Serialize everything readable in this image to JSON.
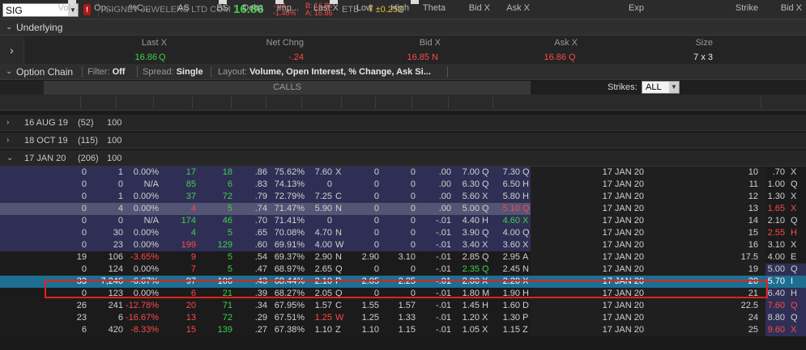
{
  "topbar": {
    "symbol": "SIG",
    "company": "SIGNET JEWELERS LTD COM",
    "last": "16.86",
    "net_change": "-.24",
    "pct_change": "-1.40%",
    "bid": "B: 16.85",
    "ask": "A: 16.86",
    "etb": "ETB",
    "hilo": "±0.252"
  },
  "underlying": {
    "title": "Underlying",
    "headers": [
      "Last X",
      "Net Chng",
      "Bid X",
      "Ask X",
      "Size"
    ],
    "last": "16.86",
    "last_ex": "Q",
    "net_chng": "-.24",
    "bid": "16.85",
    "bid_ex": "N",
    "ask": "16.86",
    "ask_ex": "Q",
    "size": "7 x 3"
  },
  "toolbar": {
    "title": "Option Chain",
    "filter_label": "Filter:",
    "filter_value": "Off",
    "spread_label": "Spread:",
    "spread_value": "Single",
    "layout_label": "Layout:",
    "layout_value": "Volume, Open Interest, % Change, Ask Si..."
  },
  "calls_label": "CALLS",
  "strikes": {
    "label": "Strikes:",
    "value": "ALL"
  },
  "columns": [
    "Vol...",
    "Op...",
    "%C...",
    "AS",
    "BS",
    "Delta",
    "Imp...",
    "Last X",
    "Low",
    "High",
    "Theta",
    "Bid X",
    "Ask X",
    "Exp",
    "Strike",
    "Bid X"
  ],
  "expirations": [
    {
      "label": "16 AUG 19",
      "count": "(52)",
      "mult": "100"
    },
    {
      "label": "18 OCT 19",
      "count": "(115)",
      "mult": "100"
    },
    {
      "label": "17 JAN 20",
      "count": "(206)",
      "mult": "100"
    }
  ],
  "rows": [
    {
      "vol": "0",
      "oi": "1",
      "pct": "0.00%",
      "as": "17",
      "bs": "18",
      "delta": ".86",
      "imp": "75.62%",
      "last": "7.60",
      "lx": "X",
      "low": "0",
      "high": "0",
      "theta": ".00",
      "bid": "7.00",
      "bx": "Q",
      "ask": "7.30",
      "ax": "Q",
      "exp": "17 JAN 20",
      "strike": "10",
      "pbid": ".70",
      "pbx": "X"
    },
    {
      "vol": "0",
      "oi": "0",
      "pct": "N/A",
      "as": "85",
      "bs": "6",
      "delta": ".83",
      "imp": "74.13%",
      "last": "0",
      "lx": "",
      "low": "0",
      "high": "0",
      "theta": ".00",
      "bid": "6.30",
      "bx": "Q",
      "ask": "6.50",
      "ax": "H",
      "exp": "17 JAN 20",
      "strike": "11",
      "pbid": "1.00",
      "pbx": "Q"
    },
    {
      "vol": "0",
      "oi": "1",
      "pct": "0.00%",
      "as": "37",
      "bs": "72",
      "delta": ".79",
      "imp": "72.79%",
      "last": "7.25",
      "lx": "C",
      "low": "0",
      "high": "0",
      "theta": ".00",
      "bid": "5.60",
      "bx": "X",
      "ask": "5.80",
      "ax": "H",
      "exp": "17 JAN 20",
      "strike": "12",
      "pbid": "1.30",
      "pbx": "X"
    },
    {
      "vol": "0",
      "oi": "4",
      "pct": "0.00%",
      "as": "4",
      "bs": "5",
      "delta": ".74",
      "imp": "71.47%",
      "last": "5.90",
      "lx": "N",
      "low": "0",
      "high": "0",
      "theta": ".00",
      "bid": "5.00",
      "bx": "Q",
      "ask": "5.10",
      "ax": "Q",
      "exp": "17 JAN 20",
      "strike": "13",
      "pbid": "1.65",
      "pbx": "X"
    },
    {
      "vol": "0",
      "oi": "0",
      "pct": "N/A",
      "as": "174",
      "bs": "46",
      "delta": ".70",
      "imp": "71.41%",
      "last": "0",
      "lx": "",
      "low": "0",
      "high": "0",
      "theta": "-.01",
      "bid": "4.40",
      "bx": "H",
      "ask": "4.60",
      "ax": "X",
      "exp": "17 JAN 20",
      "strike": "14",
      "pbid": "2.10",
      "pbx": "Q"
    },
    {
      "vol": "0",
      "oi": "30",
      "pct": "0.00%",
      "as": "4",
      "bs": "5",
      "delta": ".65",
      "imp": "70.08%",
      "last": "4.70",
      "lx": "N",
      "low": "0",
      "high": "0",
      "theta": "-.01",
      "bid": "3.90",
      "bx": "Q",
      "ask": "4.00",
      "ax": "Q",
      "exp": "17 JAN 20",
      "strike": "15",
      "pbid": "2.55",
      "pbx": "H"
    },
    {
      "vol": "0",
      "oi": "23",
      "pct": "0.00%",
      "as": "199",
      "bs": "129",
      "delta": ".60",
      "imp": "69.91%",
      "last": "4.00",
      "lx": "W",
      "low": "0",
      "high": "0",
      "theta": "-.01",
      "bid": "3.40",
      "bx": "X",
      "ask": "3.60",
      "ax": "X",
      "exp": "17 JAN 20",
      "strike": "16",
      "pbid": "3.10",
      "pbx": "X"
    },
    {
      "vol": "19",
      "oi": "106",
      "pct": "-3.65%",
      "as": "9",
      "bs": "5",
      "delta": ".54",
      "imp": "69.37%",
      "last": "2.90",
      "lx": "N",
      "low": "2.90",
      "high": "3.10",
      "theta": "-.01",
      "bid": "2.85",
      "bx": "Q",
      "ask": "2.95",
      "ax": "A",
      "exp": "17 JAN 20",
      "strike": "17.5",
      "pbid": "4.00",
      "pbx": "E"
    },
    {
      "vol": "0",
      "oi": "124",
      "pct": "0.00%",
      "as": "7",
      "bs": "5",
      "delta": ".47",
      "imp": "68.97%",
      "last": "2.65",
      "lx": "Q",
      "low": "0",
      "high": "0",
      "theta": "-.01",
      "bid": "2.35",
      "bx": "Q",
      "ask": "2.45",
      "ax": "N",
      "exp": "17 JAN 20",
      "strike": "19",
      "pbid": "5.00",
      "pbx": "Q"
    },
    {
      "vol": "33",
      "oi": "7,246",
      "pct": "-6.67%",
      "as": "97",
      "bs": "106",
      "delta": ".43",
      "imp": "68.44%",
      "last": "2.10",
      "lx": "P",
      "low": "2.05",
      "high": "2.25",
      "theta": "-.01",
      "bid": "2.00",
      "bx": "X",
      "ask": "2.20",
      "ax": "X",
      "exp": "17 JAN 20",
      "strike": "20",
      "pbid": "5.70",
      "pbx": "I"
    },
    {
      "vol": "0",
      "oi": "123",
      "pct": "0.00%",
      "as": "6",
      "bs": "21",
      "delta": ".39",
      "imp": "68.27%",
      "last": "2.05",
      "lx": "Q",
      "low": "0",
      "high": "0",
      "theta": "-.01",
      "bid": "1.80",
      "bx": "M",
      "ask": "1.90",
      "ax": "H",
      "exp": "17 JAN 20",
      "strike": "21",
      "pbid": "6.40",
      "pbx": "H"
    },
    {
      "vol": "26",
      "oi": "241",
      "pct": "-12.78%",
      "as": "20",
      "bs": "71",
      "delta": ".34",
      "imp": "67.95%",
      "last": "1.57",
      "lx": "C",
      "low": "1.55",
      "high": "1.57",
      "theta": "-.01",
      "bid": "1.45",
      "bx": "H",
      "ask": "1.60",
      "ax": "D",
      "exp": "17 JAN 20",
      "strike": "22.5",
      "pbid": "7.60",
      "pbx": "Q"
    },
    {
      "vol": "23",
      "oi": "6",
      "pct": "-16.67%",
      "as": "13",
      "bs": "72",
      "delta": ".29",
      "imp": "67.51%",
      "last": "1.25",
      "lx": "W",
      "low": "1.25",
      "high": "1.33",
      "theta": "-.01",
      "bid": "1.20",
      "bx": "X",
      "ask": "1.30",
      "ax": "P",
      "exp": "17 JAN 20",
      "strike": "24",
      "pbid": "8.80",
      "pbx": "Q"
    },
    {
      "vol": "6",
      "oi": "420",
      "pct": "-8.33%",
      "as": "15",
      "bs": "139",
      "delta": ".27",
      "imp": "67.38%",
      "last": "1.10",
      "lx": "Z",
      "low": "1.10",
      "high": "1.15",
      "theta": "-.01",
      "bid": "1.05",
      "bx": "X",
      "ask": "1.15",
      "ax": "Z",
      "exp": "17 JAN 20",
      "strike": "25",
      "pbid": "9.60",
      "pbx": "X"
    }
  ],
  "colors": {
    "itm_row": "#2f2f55",
    "otm_row": "#1b1b1b",
    "atm_row": "#545474",
    "selected_row": "#1e6e92",
    "positive": "#3ed14a",
    "negative": "#ff4848",
    "highlight": "#e2231a"
  }
}
